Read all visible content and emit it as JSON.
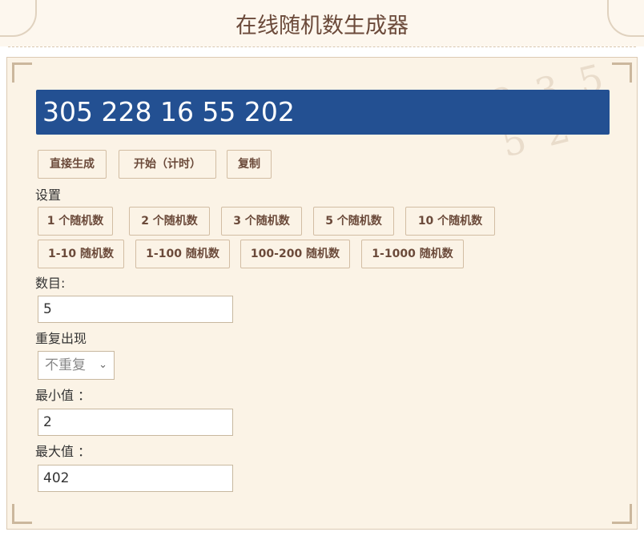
{
  "header": {
    "title": "在线随机数生成器"
  },
  "result": {
    "numbers": "305 228 16 55 202"
  },
  "actions": {
    "generate_label": "直接生成",
    "start_label": "开始（计时）",
    "copy_label": "复制"
  },
  "settings": {
    "heading": "设置",
    "count_presets": [
      "1 个随机数",
      "2 个随机数",
      "3 个随机数",
      "5 个随机数",
      "10 个随机数"
    ],
    "range_presets": [
      "1-10 随机数",
      "1-100 随机数",
      "100-200 随机数",
      "1-1000 随机数"
    ]
  },
  "form": {
    "count_label": "数目:",
    "count_value": "5",
    "repeat_label": "重复出现",
    "repeat_value": "不重复",
    "min_label": "最小值 ：",
    "min_value": "2",
    "max_label": "最大值 ：",
    "max_value": "402"
  },
  "decor": {
    "watermark": "2 3 5\n5 2 7\n6 ✱"
  }
}
